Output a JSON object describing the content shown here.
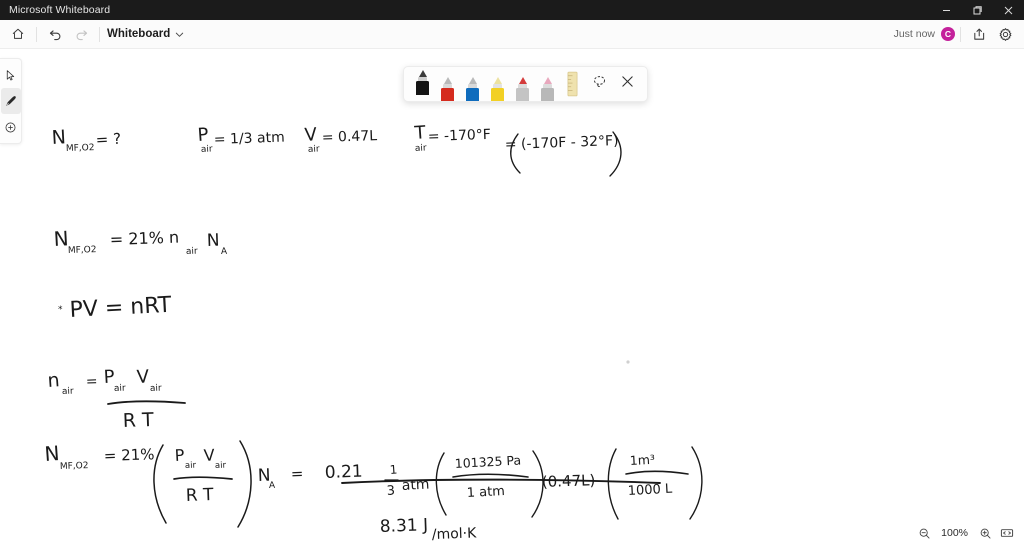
{
  "window": {
    "app_title": "Microsoft Whiteboard",
    "controls": {
      "minimize": "minimize",
      "restore": "restore",
      "close": "close"
    }
  },
  "commandbar": {
    "home_label": "Home",
    "undo_label": "Undo",
    "redo_label": "Redo",
    "board_name": "Whiteboard",
    "board_menu_chevron": "chevron-down",
    "saved_status": "Just now",
    "avatar_initial": "C",
    "share_label": "Share",
    "settings_label": "Settings"
  },
  "rail": {
    "items": [
      {
        "name": "select",
        "label": "Select",
        "active": false
      },
      {
        "name": "ink",
        "label": "Ink",
        "active": true
      },
      {
        "name": "insert",
        "label": "Create",
        "active": false
      }
    ]
  },
  "pen_toolbar": {
    "pens": [
      {
        "name": "pen-black",
        "label": "Black pen",
        "color": "#141414",
        "selected": true
      },
      {
        "name": "pen-red",
        "label": "Red pen",
        "color": "#d52b1e",
        "selected": false
      },
      {
        "name": "pen-blue",
        "label": "Blue pen",
        "color": "#0f6cbd",
        "selected": false
      },
      {
        "name": "highlighter-yellow",
        "label": "Yellow highlighter",
        "color": "#f2d024",
        "selected": false
      },
      {
        "name": "pen-gray",
        "label": "Gray pen",
        "color": "#b9b9b9",
        "selected": false
      },
      {
        "name": "pen-pink",
        "label": "Pink pen",
        "color": "#e8a8bd",
        "selected": false
      }
    ],
    "ruler_label": "Ruler",
    "lasso_label": "Lasso select",
    "close_label": "Close"
  },
  "zoom_control": {
    "zoom_out_label": "Zoom out",
    "zoom_level": "100%",
    "zoom_in_label": "Zoom in",
    "fit_label": "Fit to screen"
  },
  "ink_notes": {
    "line1": {
      "var_unknown": "N",
      "var_unknown_sub": "MF,O2",
      "var_unknown_eq": "= ?",
      "pressure": "P",
      "pressure_sub": "air",
      "pressure_val": "= 1/3 atm",
      "volume": "V",
      "volume_sub": "air",
      "volume_val": "= 0.47L",
      "temp": "T",
      "temp_sub": "air",
      "temp_val": "= -170°F",
      "temp_conv": "= (-170F - 32°F)"
    },
    "line2": {
      "lhs": "N",
      "lhs_sub": "MF,O2",
      "rhs": "= 21%  n",
      "rhs_sub1": "air",
      "rhs_tail": "N",
      "rhs_sub2": "A"
    },
    "line3": {
      "marker": "*",
      "equation": "PV = nRT"
    },
    "line4": {
      "lhs": "n",
      "lhs_sub": "air",
      "eq": "=",
      "numerator_p": "P",
      "numerator_p_sub": "air",
      "numerator_v": "V",
      "numerator_v_sub": "air",
      "denominator": "R T"
    },
    "line5": {
      "lhs": "N",
      "lhs_sub": "MF,O2",
      "eq": "= 21%",
      "frac_num_p": "P",
      "frac_num_p_sub": "air",
      "frac_num_v": "V",
      "frac_num_v_sub": "air",
      "frac_den": "R T",
      "avogadro": "N",
      "avogadro_sub": "A",
      "result_eq": "=",
      "coefficient": "0.21",
      "term_frac_num": "1",
      "term_frac_den": "3",
      "term_unit": "atm",
      "conv1_num": "101325 Pa",
      "conv1_den": "1 atm",
      "volume_term": "(0.47L)",
      "conv2_num": "1m³",
      "conv2_den": "1000 L",
      "gas_constant": "8.31 J",
      "gas_constant_unit": "/mol·K"
    }
  }
}
